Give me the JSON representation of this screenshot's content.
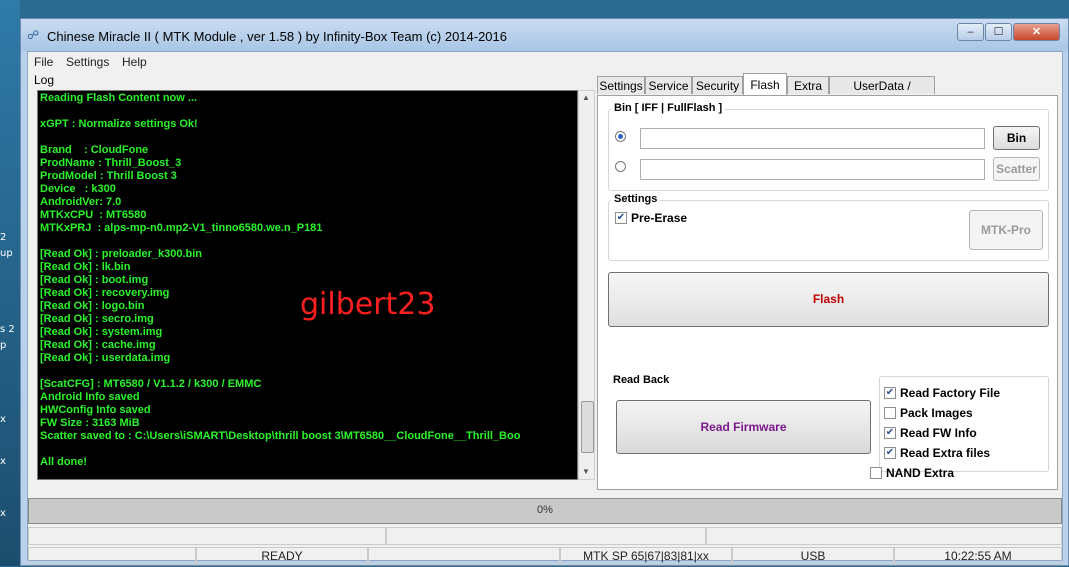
{
  "window": {
    "title": "Chinese Miracle II ( MTK Module , ver 1.58 ) by Infinity-Box Team (c) 2014-2016",
    "minimize": "–",
    "maximize": "☐",
    "close": "✕"
  },
  "desktop_fragments": [
    "2",
    "up",
    "s 2",
    "p",
    "x",
    "x",
    "x"
  ],
  "menu": [
    "File",
    "Settings",
    "Help"
  ],
  "log": {
    "label": "Log",
    "lines": [
      "Reading Flash Content now ...",
      "",
      "xGPT : Normalize settings Ok!",
      "",
      "Brand    : CloudFone",
      "ProdName : Thrill_Boost_3",
      "ProdModel : Thrill Boost 3",
      "Device   : k300",
      "AndroidVer: 7.0",
      "MTKxCPU  : MT6580",
      "MTKxPRJ  : alps-mp-n0.mp2-V1_tinno6580.we.n_P181",
      "",
      "[Read Ok] : preloader_k300.bin",
      "[Read Ok] : lk.bin",
      "[Read Ok] : boot.img",
      "[Read Ok] : recovery.img",
      "[Read Ok] : logo.bin",
      "[Read Ok] : secro.img",
      "[Read Ok] : system.img",
      "[Read Ok] : cache.img",
      "[Read Ok] : userdata.img",
      "",
      "[ScatCFG] : MT6580 / V1.1.2 / k300 / EMMC",
      "Android Info saved",
      "HWConfig Info saved",
      "FW Size : 3163 MiB",
      "Scatter saved to : C:\\Users\\iSMART\\Desktop\\thrill boost 3\\MT6580__CloudFone__Thrill_Boo",
      "",
      "All done!"
    ],
    "watermark": "gilbert23"
  },
  "tabs": [
    {
      "label": "Settings",
      "active": false
    },
    {
      "label": "Service",
      "active": false
    },
    {
      "label": "Security",
      "active": false
    },
    {
      "label": "Flash",
      "active": true
    },
    {
      "label": "Extra",
      "active": false
    },
    {
      "label": "UserData / Forensic",
      "active": false
    }
  ],
  "flash": {
    "bin_group_label": "Bin  [ IFF | FullFlash ]",
    "bin_button": "Bin",
    "scatter_button": "Scatter",
    "bin_path": "",
    "scatter_path": "",
    "settings_label": "Settings",
    "pre_erase_label": "Pre-Erase",
    "pre_erase_checked": true,
    "mtk_pro_button": "MTK-Pro",
    "flash_button": "Flash",
    "flash_color": "#c00000",
    "read_back_label": "Read Back",
    "read_firmware_button": "Read Firmware",
    "read_firmware_color": "#7a1a8a",
    "options": [
      {
        "label": "Read Factory File",
        "checked": true
      },
      {
        "label": "Pack Images",
        "checked": false
      },
      {
        "label": "Read FW Info",
        "checked": true
      },
      {
        "label": "Read Extra files",
        "checked": true
      }
    ],
    "nand_extra_label": "NAND Extra",
    "nand_extra_checked": false
  },
  "progress": {
    "value": 0,
    "text": "0%"
  },
  "status": {
    "state": "READY",
    "module": "MTK SP 65|67|83|81|xx",
    "connection": "USB",
    "time": "10:22:55 AM"
  }
}
